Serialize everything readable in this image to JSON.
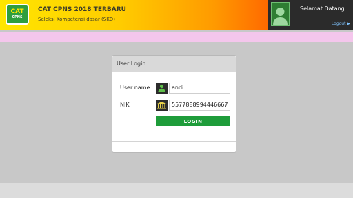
{
  "header": {
    "logo_text_top": "CAT",
    "logo_text_bottom": "CPNS",
    "title": "CAT CPNS 2018 TERBARU",
    "subtitle": "Seleksi Kompetensi dasar (SKD)"
  },
  "user_panel": {
    "welcome": "Selamat Datang",
    "logout": "Logout ▶"
  },
  "login_panel": {
    "title": "User Login",
    "username_label": "User name",
    "username_value": "andi",
    "nik_label": "NIK",
    "nik_value": "5577888994446667",
    "login_button": "LOGIN"
  },
  "colors": {
    "accent": "#1e9c3a",
    "header_gradient_start": "#ffe600",
    "header_gradient_end": "#ff6a00",
    "pink_bar": "#f4c6ec"
  },
  "icons": [
    "logo-emblem",
    "user-silhouette-icon",
    "user-icon",
    "bank-icon"
  ]
}
